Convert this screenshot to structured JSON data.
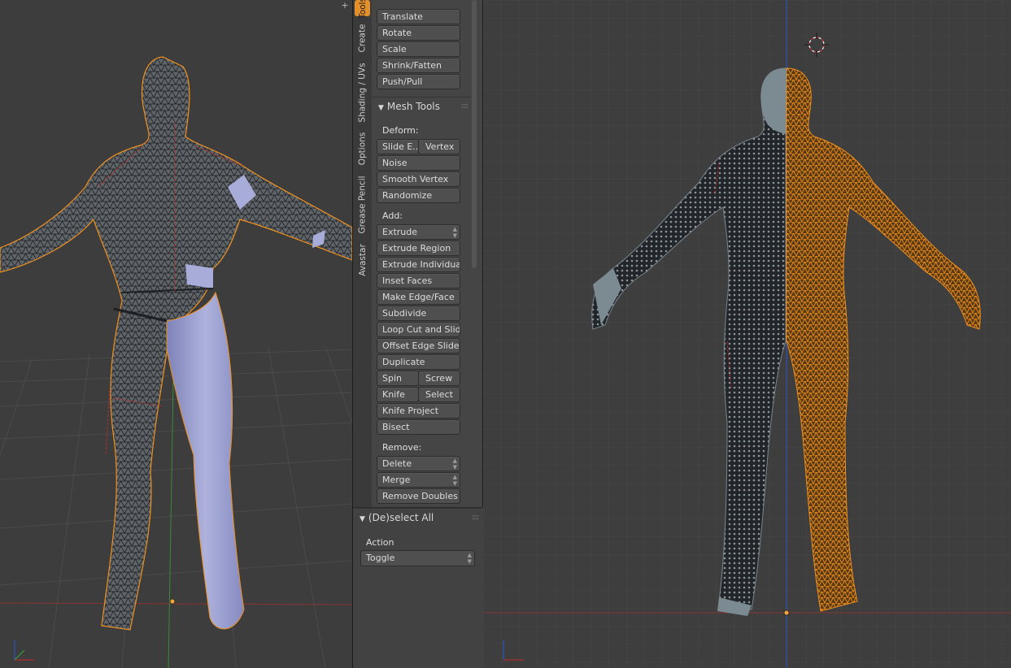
{
  "tabs": [
    "Tools",
    "Create",
    "Shading / UVs",
    "Options",
    "Grease Pencil",
    "Avastar"
  ],
  "active_tab": "Tools",
  "transform": {
    "buttons": [
      "Translate",
      "Rotate",
      "Scale",
      "Shrink/Fatten",
      "Push/Pull"
    ]
  },
  "mesh_tools": {
    "title": "Mesh Tools",
    "deform_label": "Deform:",
    "slide_edge": "Slide E..",
    "vertex": "Vertex",
    "noise": "Noise",
    "smooth_vertex": "Smooth Vertex",
    "randomize": "Randomize",
    "add_label": "Add:",
    "extrude": "Extrude",
    "extrude_region": "Extrude Region",
    "extrude_individual": "Extrude Individual",
    "inset_faces": "Inset Faces",
    "make_edge_face": "Make Edge/Face",
    "subdivide": "Subdivide",
    "loop_cut_and_slide": "Loop Cut and Slide",
    "offset_edge_slide": "Offset Edge Slide",
    "duplicate": "Duplicate",
    "spin": "Spin",
    "screw": "Screw",
    "knife": "Knife",
    "select": "Select",
    "knife_project": "Knife Project",
    "bisect": "Bisect",
    "remove_label": "Remove:",
    "delete": "Delete",
    "merge": "Merge",
    "remove_doubles": "Remove Doubles"
  },
  "operator": {
    "title": "(De)select All",
    "action_label": "Action",
    "action_value": "Toggle"
  },
  "axis": {
    "z": "z",
    "y": "y",
    "x": "x"
  },
  "colors": {
    "selected": "#f0901e",
    "mesh_dark": "#2a2d2f",
    "mesh_grey": "#6d7a80",
    "skin": "#9ea2d0",
    "grid_line": "#4a4a4a",
    "x_axis": "#9b2f2f",
    "y_axis": "#3a8a3a",
    "z_axis": "#2f4ea8"
  }
}
